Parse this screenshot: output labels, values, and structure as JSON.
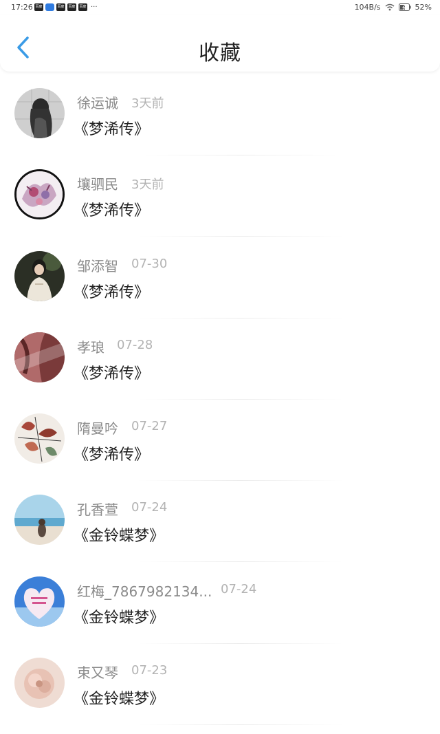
{
  "status_bar": {
    "time": "17:26",
    "notif_labels": [
      "百度",
      "",
      "百度",
      "百度",
      "百度"
    ],
    "more": "···",
    "speed": "104B/s",
    "battery": "52%"
  },
  "header": {
    "title": "收藏"
  },
  "items": [
    {
      "name": "徐运诚",
      "time": "3天前",
      "title": "《梦浠传》"
    },
    {
      "name": "壤驷民",
      "time": "3天前",
      "title": "《梦浠传》"
    },
    {
      "name": "邹添智",
      "time": "07-30",
      "title": "《梦浠传》"
    },
    {
      "name": "孝琅",
      "time": "07-28",
      "title": "《梦浠传》"
    },
    {
      "name": "隋曼吟",
      "time": "07-27",
      "title": "《梦浠传》"
    },
    {
      "name": "孔香萱",
      "time": "07-24",
      "title": "《金铃蝶梦》"
    },
    {
      "name": "红梅_7867982134...",
      "time": "07-24",
      "title": "《金铃蝶梦》"
    },
    {
      "name": "束又琴",
      "time": "07-23",
      "title": "《金铃蝶梦》"
    }
  ],
  "colors": {
    "accent": "#3a9be6",
    "name": "#8a8a8a",
    "time": "#b3b3b3",
    "title": "#222222"
  }
}
